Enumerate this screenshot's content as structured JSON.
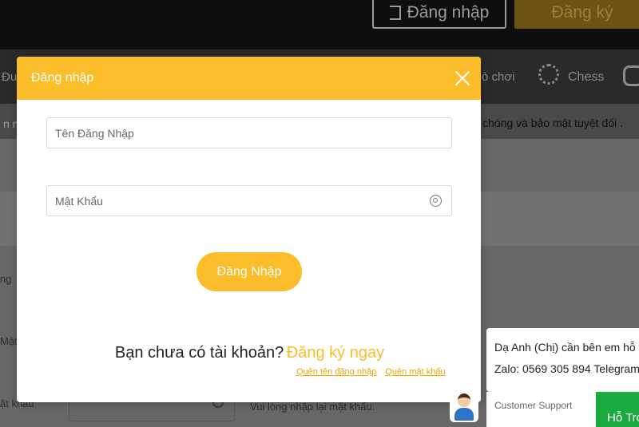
{
  "background": {
    "header": {
      "login_label": "Đăng nhập",
      "register_label": "Đăng ký"
    },
    "nav": {
      "left_fragment": "Đu",
      "games_fragment": "ò chơi",
      "chess_label": "Chess"
    },
    "marquee": {
      "left_fragment": "n ma",
      "right_text": "chóng và bảo mật tuyệt đối ."
    },
    "form": {
      "label_1": "ng",
      "label_2": "Mật",
      "label_3": "ật khẩu",
      "hint": "Vui lòng nhập lại mật khẩu."
    }
  },
  "modal": {
    "title": "Đăng nhập",
    "username_placeholder": "Tên Đăng Nhập",
    "password_placeholder": "Mật Khẩu",
    "submit_label": "Đăng Nhập",
    "no_account_text": "Bạn chưa có tài khoản?",
    "signup_link": "Đăng ký ngay",
    "forgot_username": "Quên tên đăng nhập",
    "forgot_password": "Quên mật khẩu"
  },
  "chat": {
    "line1": "Dạ Anh (Chị) cần bên em hỗ trợ",
    "line2": "Zalo: 0569 305 894 Telegram",
    "support_label": "Customer Support",
    "button_label": "Hỗ Trợ"
  },
  "colors": {
    "accent": "#fbbd2a",
    "support_green": "#1aaa3f"
  }
}
